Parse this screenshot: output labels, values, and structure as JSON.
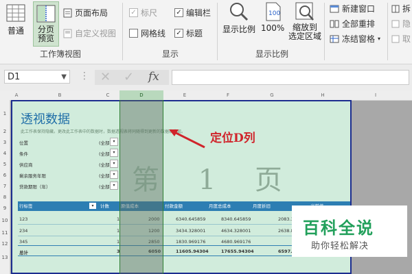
{
  "ribbon": {
    "workbook_views": {
      "normal": "普通",
      "page_break_preview": "分页\n预览",
      "page_layout": "页面布局",
      "custom_views": "自定义视图",
      "group_label": "工作簿视图"
    },
    "show": {
      "ruler": "标尺",
      "formula_bar": "编辑栏",
      "gridlines": "网格线",
      "headings": "标题",
      "group_label": "显示"
    },
    "zoom": {
      "zoom": "显示比例",
      "hundred": "100%",
      "zoom_selection": "缩放到\n选定区域",
      "group_label": "显示比例"
    },
    "window": {
      "new_window": "新建窗口",
      "arrange_all": "全部重排",
      "freeze_panes": "冻结窗格",
      "split": "拆",
      "hide": "隐",
      "unhide": "取"
    }
  },
  "formula_bar": {
    "name_box": "D1",
    "fx": "fx",
    "formula": ""
  },
  "sheet": {
    "columns": [
      "A",
      "B",
      "C",
      "D",
      "E",
      "F",
      "G",
      "H",
      "I"
    ],
    "rows": [
      "1",
      "2",
      "3",
      "4",
      "5",
      "6",
      "7",
      "8",
      "9",
      "10",
      "11",
      "12",
      "13"
    ],
    "title": "透视数据",
    "description": "此工作表保持隐藏。更改此工作表中的数据时，数据透视表将同随得到更新的数据表出现。",
    "filters": [
      {
        "label": "位置",
        "value": "(全部)"
      },
      {
        "label": "条件",
        "value": "(全部)"
      },
      {
        "label": "供应商",
        "value": "(全部)"
      },
      {
        "label": "剩余服务年限",
        "value": "(全部)"
      },
      {
        "label": "贷款期限（年）",
        "value": "(全部)"
      }
    ],
    "watermark": "第 1 页",
    "table": {
      "headers": [
        "行标签",
        "计数",
        "原值成本",
        "付款金额",
        "月度总成本",
        "月度折旧",
        "当前值"
      ],
      "rows": [
        [
          "123",
          "1",
          "2000",
          "6340.645859",
          "8340.645859",
          "2083.3"
        ],
        [
          "234",
          "1",
          "1200",
          "3434.328001",
          "4634.328001",
          "2638.8"
        ],
        [
          "345",
          "1",
          "2850",
          "1830.969176",
          "4680.969176",
          ""
        ]
      ],
      "total": [
        "总计",
        "3",
        "6050",
        "11605.94304",
        "17655.94304",
        "6597.2"
      ]
    }
  },
  "annotation": "定位D列",
  "logo": {
    "title": "百科全说",
    "subtitle": "助你轻松解决"
  },
  "colors": {
    "ribbon_bg": "#f3f3f3",
    "page_bg": "#d1ecdc",
    "page_border": "#1b2d8f",
    "table_header": "#2d7eb3",
    "annotation": "#d0242b",
    "logo": "#22a05b"
  }
}
